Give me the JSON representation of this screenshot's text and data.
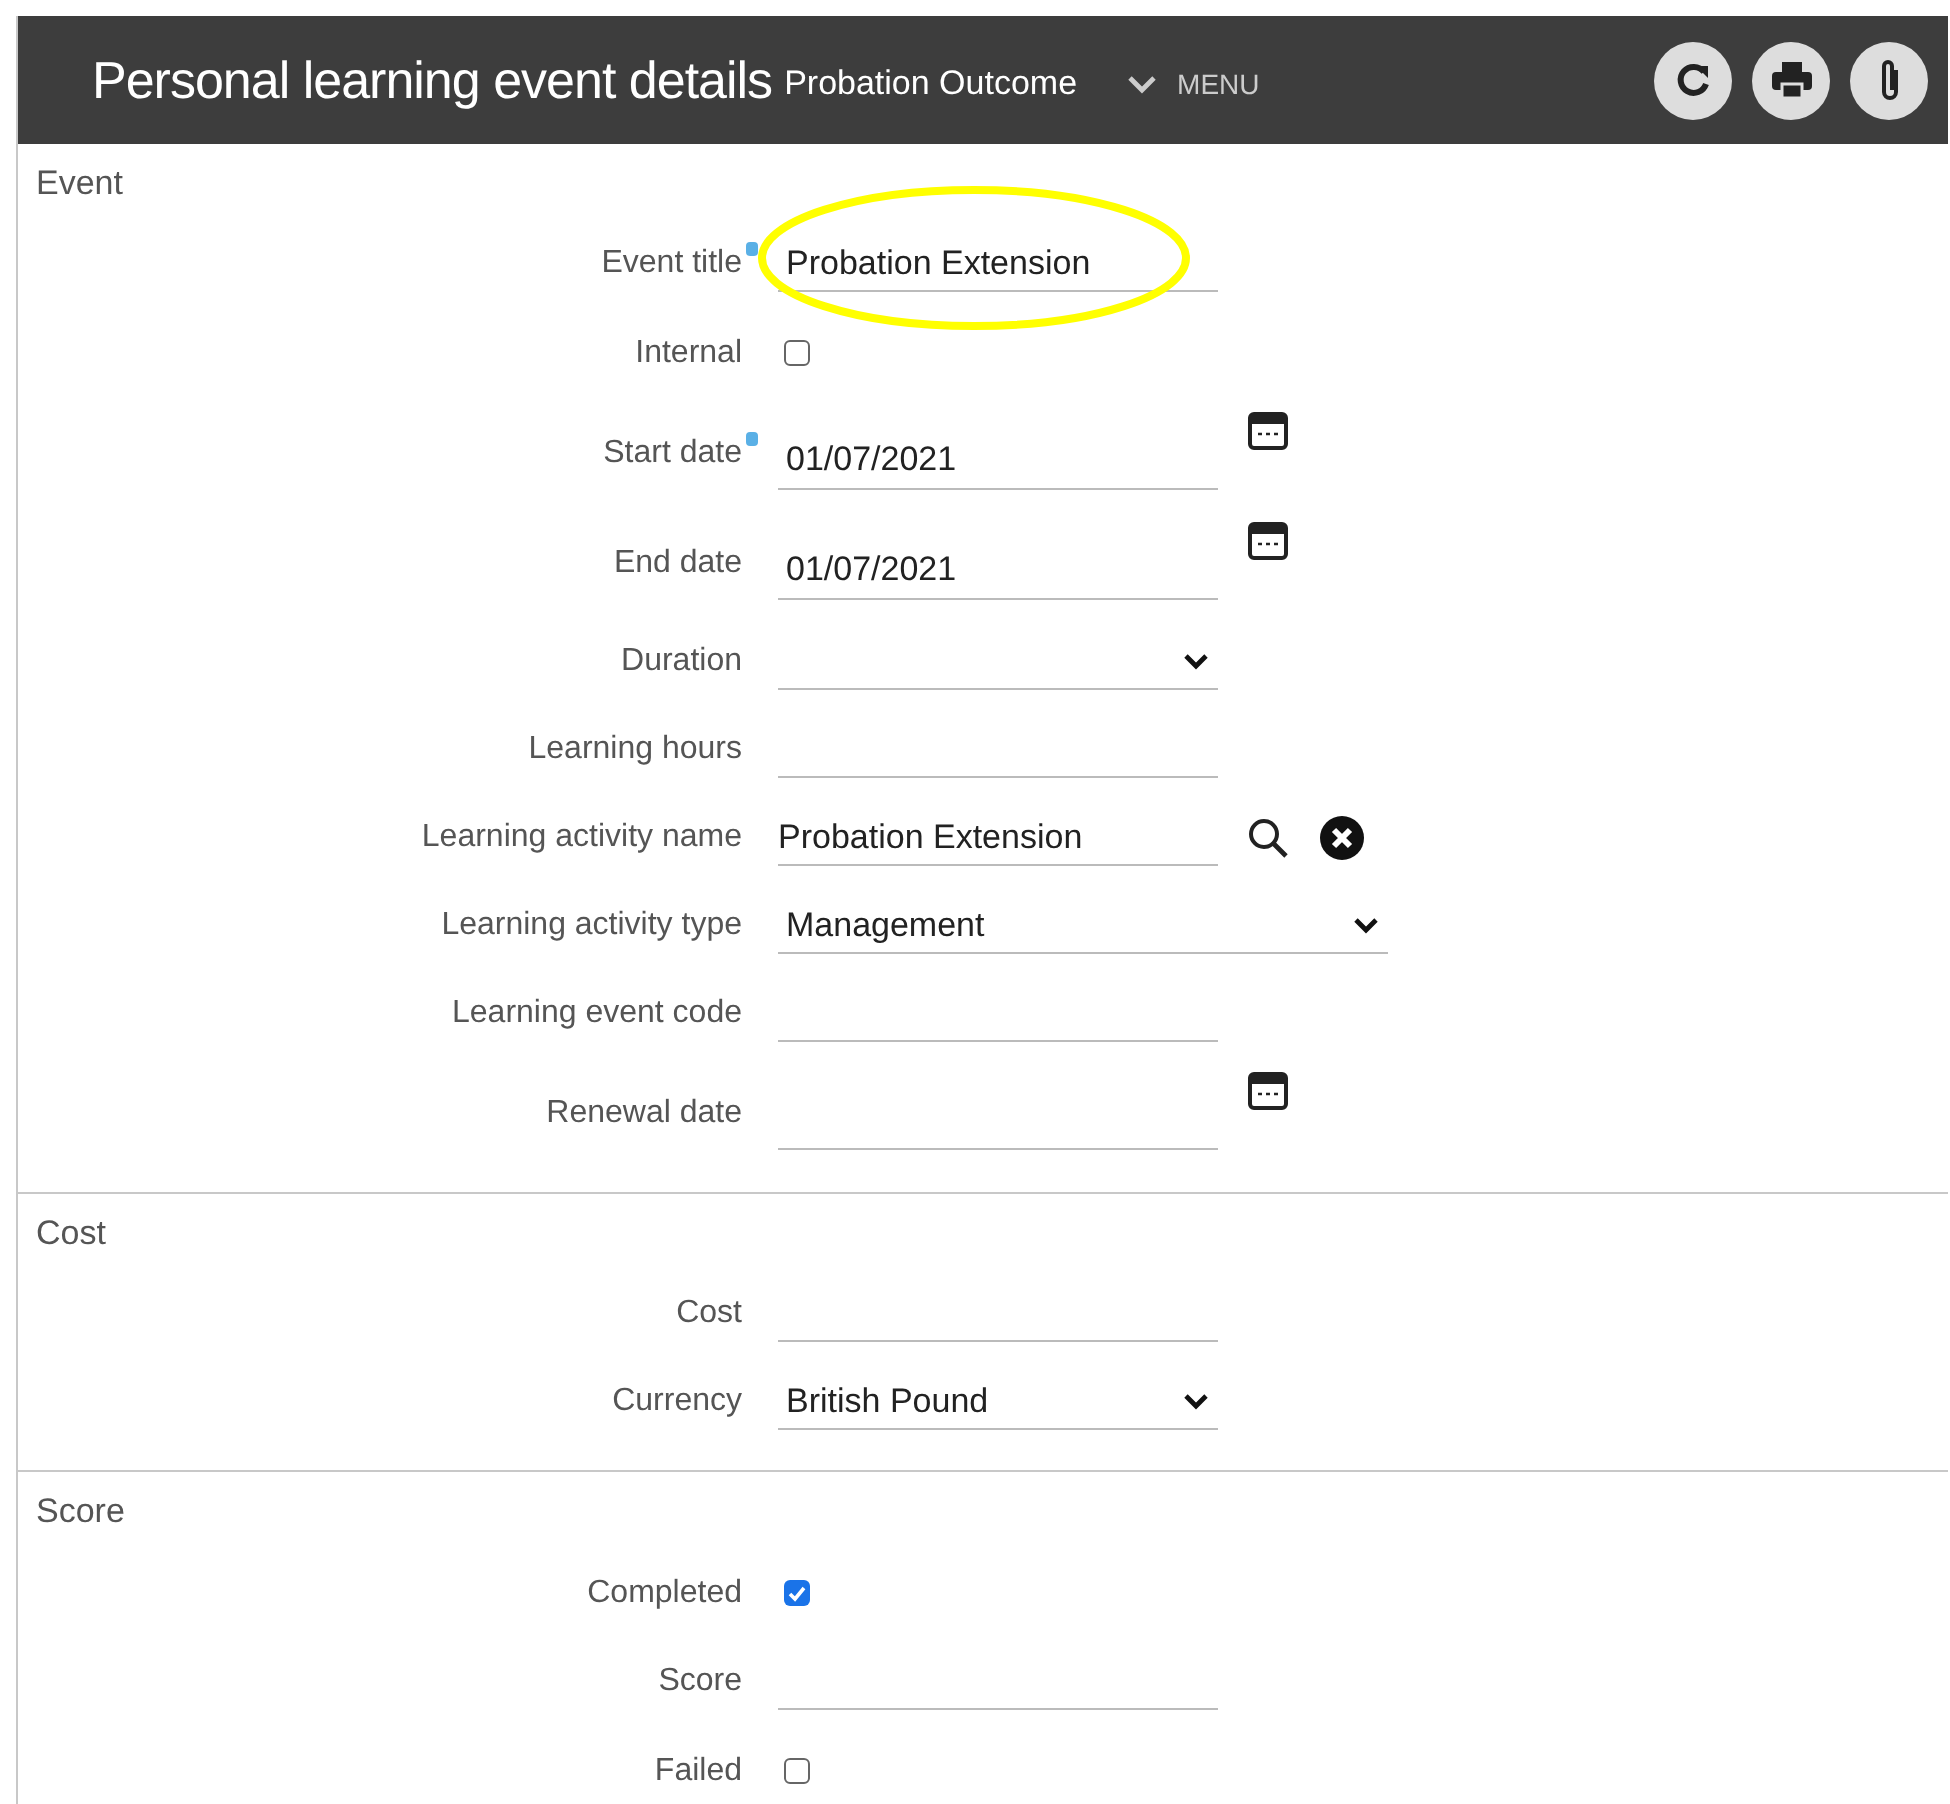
{
  "header": {
    "title": "Personal learning event details",
    "subtitle": "Probation Outcome",
    "menu": "MENU"
  },
  "sections": [
    {
      "title": "Event",
      "fields": [
        {
          "label": "Event title",
          "kind": "text",
          "value": "Probation Extension",
          "required": true,
          "highlighted": true
        },
        {
          "label": "Internal",
          "kind": "checkbox",
          "checked": false
        },
        {
          "label": "Start date",
          "kind": "date",
          "value": "01/07/2021",
          "required": true
        },
        {
          "label": "End date",
          "kind": "date",
          "value": "01/07/2021"
        },
        {
          "label": "Duration",
          "kind": "select"
        },
        {
          "label": "Learning hours",
          "kind": "text"
        },
        {
          "label": "Learning activity name",
          "kind": "lookup",
          "value": "Probation Extension"
        },
        {
          "label": "Learning activity type",
          "kind": "select",
          "value": "Management",
          "wide": true
        },
        {
          "label": "Learning event code",
          "kind": "text"
        },
        {
          "label": "Renewal date",
          "kind": "date"
        }
      ]
    },
    {
      "title": "Cost",
      "fields": [
        {
          "label": "Cost",
          "kind": "text"
        },
        {
          "label": "Currency",
          "kind": "select",
          "value": "British Pound"
        }
      ]
    },
    {
      "title": "Score",
      "fields": [
        {
          "label": "Completed",
          "kind": "checkbox",
          "checked": true
        },
        {
          "label": "Score",
          "kind": "text"
        },
        {
          "label": "Failed",
          "kind": "checkbox",
          "checked": false
        }
      ]
    }
  ]
}
